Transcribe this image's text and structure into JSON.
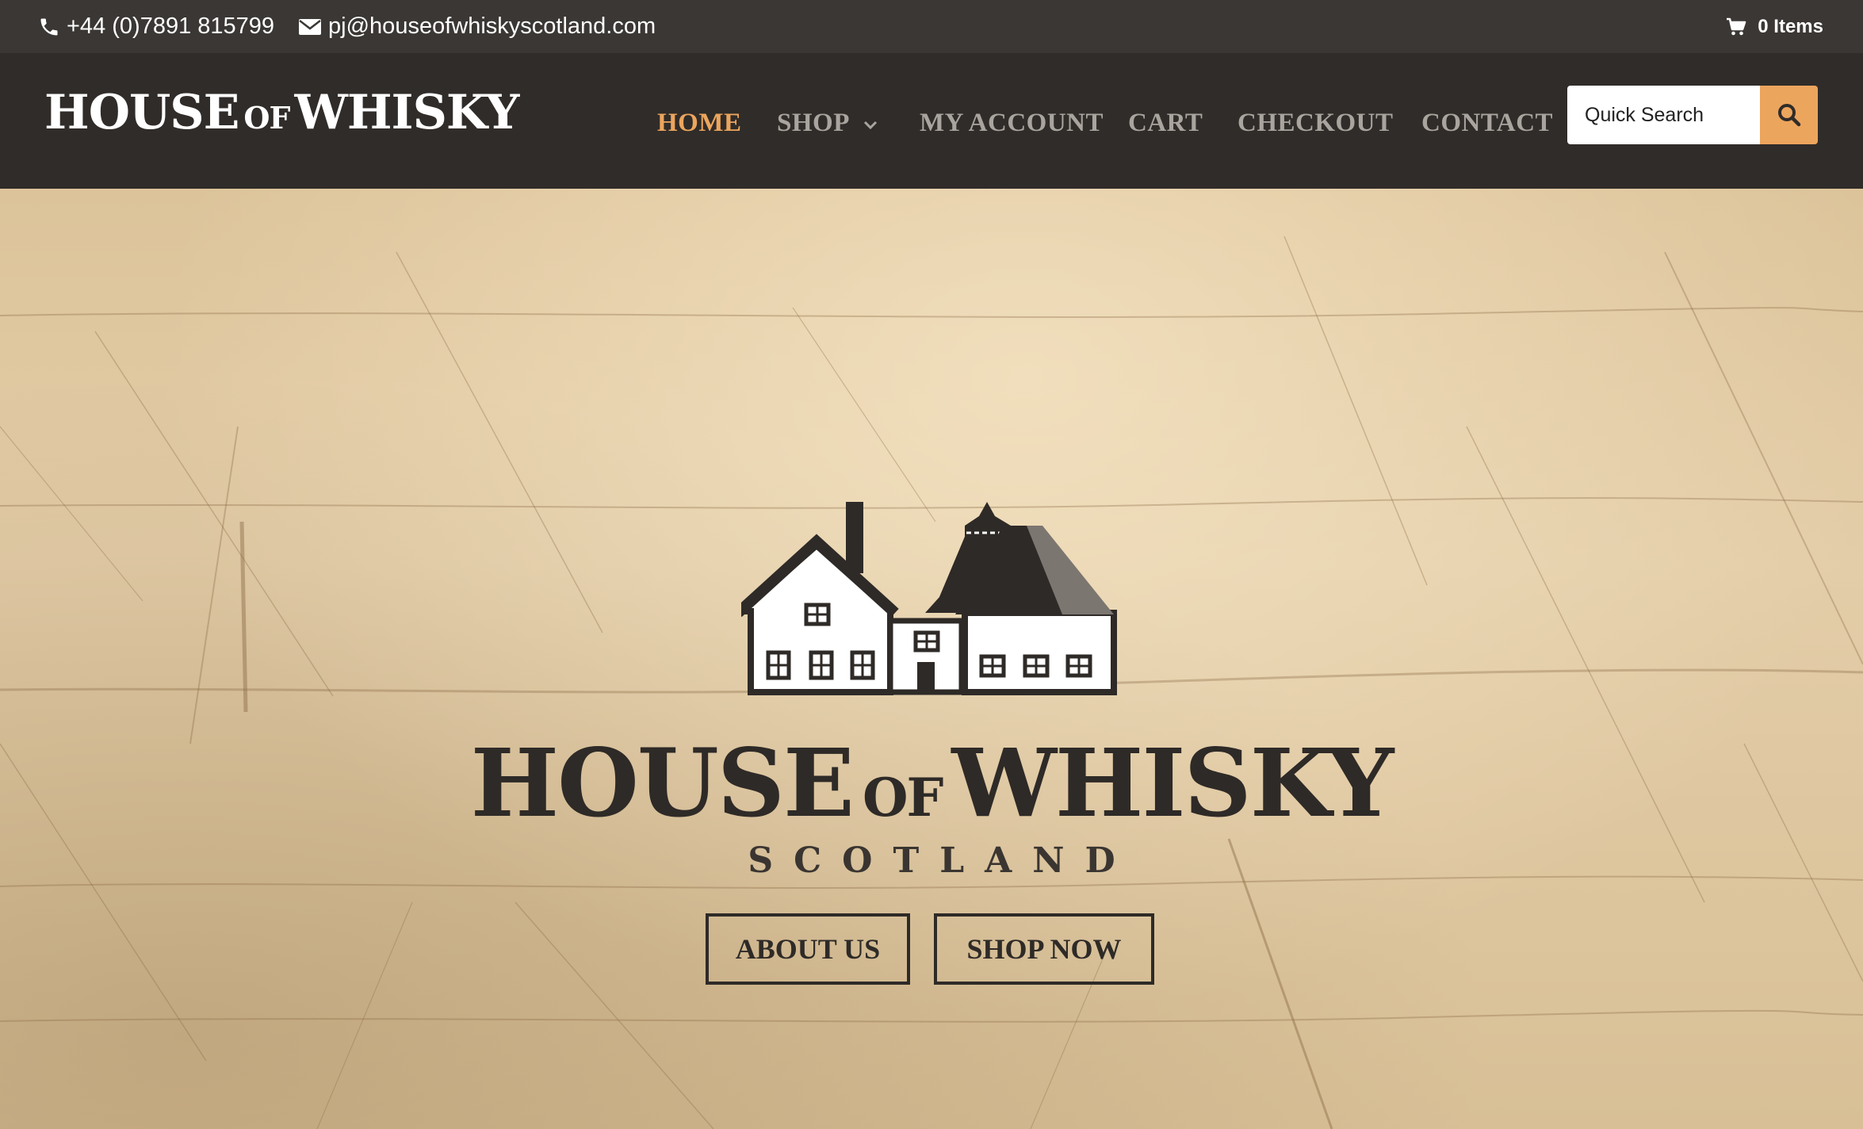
{
  "topbar": {
    "phone": "+44 (0)7891 815799",
    "email": "pj@houseofwhiskyscotland.com",
    "cart_label": "0 Items",
    "icons": {
      "phone": "phone-icon",
      "email": "envelope-icon",
      "cart": "cart-icon"
    }
  },
  "header": {
    "logo": {
      "big1": "HOUSE",
      "of": "OF",
      "big2": "WHISKY"
    },
    "nav": [
      {
        "label": "HOME",
        "active": true
      },
      {
        "label": "SHOP",
        "has_dropdown": true
      },
      {
        "label": "MY ACCOUNT"
      },
      {
        "label": "CART"
      },
      {
        "label": "CHECKOUT"
      },
      {
        "label": "CONTACT"
      }
    ],
    "search": {
      "placeholder": "Quick Search",
      "icon": "search-icon"
    }
  },
  "hero": {
    "title": {
      "big1": "HOUSE",
      "of": "OF",
      "big2": "WHISKY"
    },
    "subtitle": "SCOTLAND",
    "buttons": {
      "about": "ABOUT US",
      "shop": "SHOP NOW"
    }
  },
  "colors": {
    "topbar_bg": "#3a3734",
    "header_bg": "#302c29",
    "accent": "#eca55d",
    "nav_text": "#a9a49e",
    "dark_text": "#2e2a27"
  }
}
